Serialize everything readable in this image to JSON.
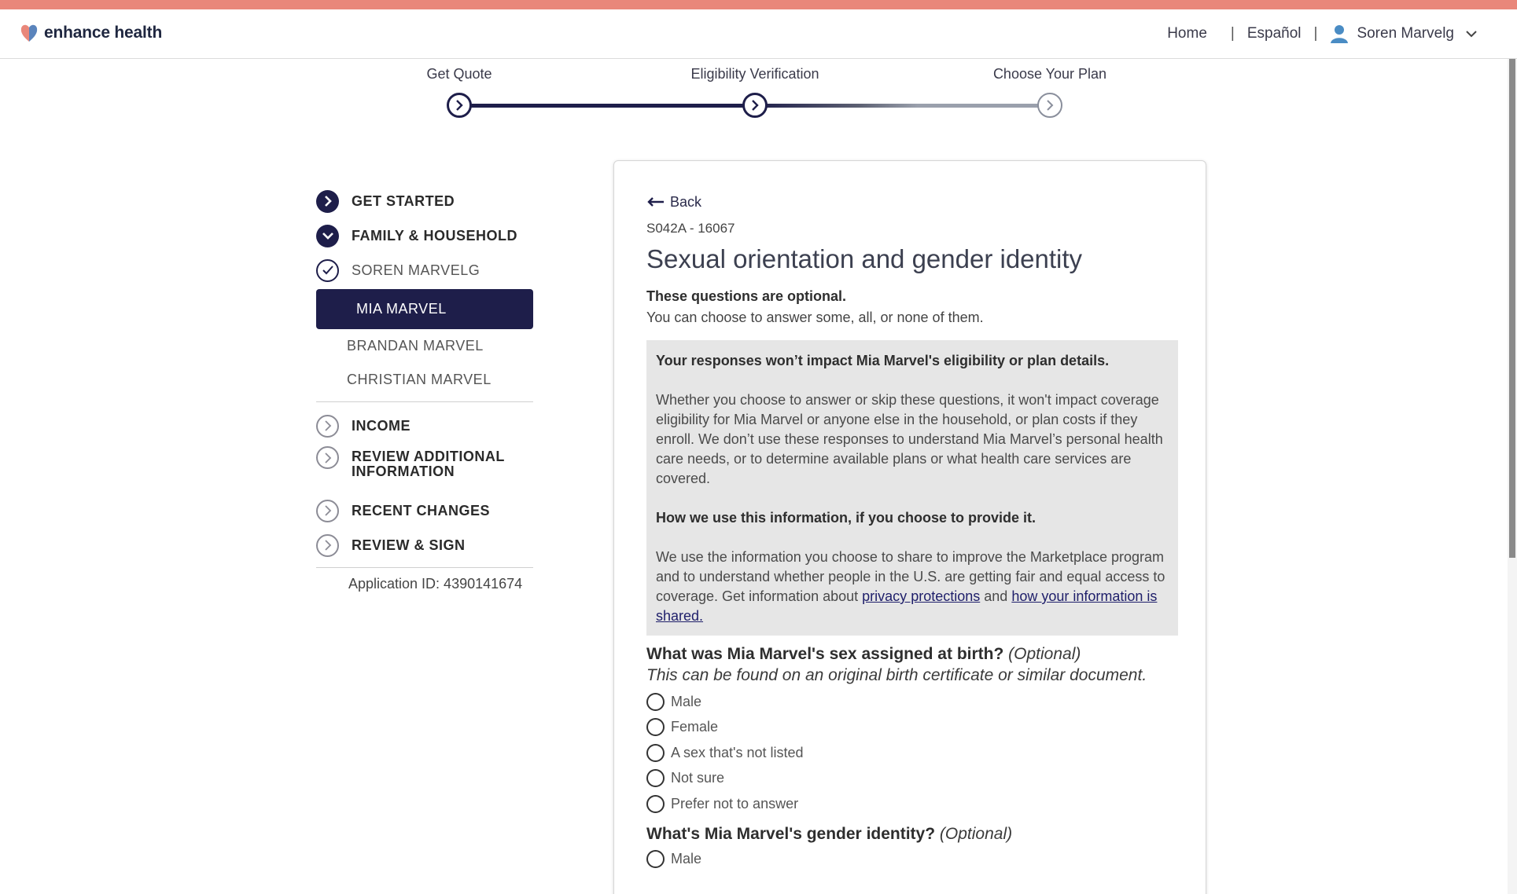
{
  "brand": {
    "name": "enhance health",
    "accent": "#e9877a",
    "navy": "#1e1e4a"
  },
  "nav": {
    "home": "Home",
    "separator": "|",
    "language": "Español",
    "user_name": "Soren Marvelg"
  },
  "stepper": {
    "steps": [
      {
        "label": "Get Quote",
        "state": "complete"
      },
      {
        "label": "Eligibility Verification",
        "state": "current"
      },
      {
        "label": "Choose Your Plan",
        "state": "upcoming"
      }
    ]
  },
  "sidebar": {
    "get_started": "GET STARTED",
    "family_household": "FAMILY & HOUSEHOLD",
    "member_soren": "SOREN MARVELG",
    "member_mia": "MIA MARVEL",
    "member_brandan": "BRANDAN MARVEL",
    "member_christian": "CHRISTIAN MARVEL",
    "income": "INCOME",
    "review_additional_1": "REVIEW ADDITIONAL",
    "review_additional_2": "INFORMATION",
    "recent_changes": "RECENT CHANGES",
    "review_sign": "REVIEW & SIGN",
    "application_id": "Application ID: 4390141674"
  },
  "main": {
    "back_label": "Back",
    "code": "S042A - 16067",
    "title": "Sexual orientation and gender identity",
    "optional_heading": "These questions are optional.",
    "optional_sub": "You can choose to answer some, all, or none of them.",
    "info": {
      "heading1": "Your responses won’t impact Mia Marvel's eligibility or plan details.",
      "para1": "Whether you choose to answer or skip these questions, it won't impact coverage eligibility for Mia Marvel or anyone else in the household, or plan costs if they enroll. We don’t use these responses to understand Mia Marvel’s personal health care needs, or to determine available plans or what health care services are covered.",
      "heading2": "How we use this information, if you choose to provide it.",
      "para2": "We use the information you choose to share to improve the Marketplace program and to understand whether people in the U.S. are getting fair and equal access to coverage. Get information about",
      "link1": "privacy protections",
      "and": "and",
      "link2": "how your information is shared."
    },
    "q1": {
      "question": "What was Mia Marvel's sex assigned at birth?",
      "optional": "(Optional)",
      "hint": "This can be found on an original birth certificate or similar document.",
      "options": [
        "Male",
        "Female",
        "A sex that's not listed",
        "Not sure",
        "Prefer not to answer"
      ]
    },
    "q2": {
      "question": "What's Mia Marvel's gender identity?",
      "optional": "(Optional)",
      "options": [
        "Male"
      ]
    }
  }
}
